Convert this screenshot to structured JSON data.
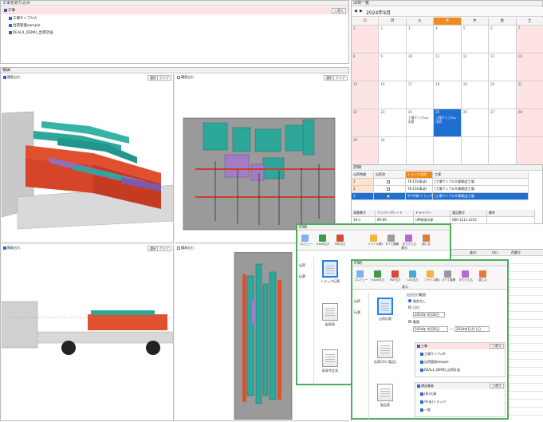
{
  "work_selector": {
    "title": "工事を絞り込み",
    "root_label": "工事",
    "button": "入替え",
    "items": [
      "工場サンプルA",
      "出荷管理sample",
      "REAL4_DEMO_出荷計画"
    ]
  },
  "viewer_panel": {
    "title": "積図",
    "view_label": "積表出力",
    "select_btn": "選択",
    "clear_btn": "クリア"
  },
  "calendar_panel": {
    "title": "出荷一覧",
    "month": "2024年9月",
    "weekdays": [
      "日",
      "月",
      "火",
      "水",
      "木",
      "金",
      "土"
    ],
    "days": [
      [
        "1",
        "2",
        "3",
        "4",
        "5",
        "6",
        "7"
      ],
      [
        "8",
        "9",
        "10",
        "11",
        "12",
        "13",
        "14"
      ],
      [
        "15",
        "16",
        "17",
        "18",
        "19",
        "20",
        "21"
      ],
      [
        "22",
        "23",
        "24",
        "25",
        "26",
        "27",
        "28"
      ],
      [
        "29",
        "30",
        "",
        "",
        "",
        "",
        ""
      ]
    ],
    "event_a": "工場サンプルA 出荷",
    "event_b": "工場サンプルA 出荷"
  },
  "detail_panel": {
    "title": "詳細",
    "headers": [
      "出荷時間",
      "出荷済",
      "トラック名称",
      "工事"
    ],
    "rows": [
      [
        "1",
        "",
        "T8-15t(車送)",
        "[工場サンプルA]車動会工場"
      ],
      [
        "2",
        "",
        "T8-15t(車送)",
        "[工場サンプルA]車動会工場"
      ],
      [
        "3",
        "",
        "ST-中車(トラック)",
        "[工場サンプルA]車動会工場"
      ]
    ],
    "vehicle_headers": [
      "車番番号",
      "ナンバープレート",
      "ドライバー",
      "電話番号",
      "備考"
    ],
    "vehicle_row": [
      "19-3",
      "89-89",
      "UM物流太郎",
      "080-1111-2222",
      ""
    ]
  },
  "print_dialog_a": {
    "title": "印刷",
    "tools": [
      "プレビュー",
      "Excel出力",
      "PDF出力",
      "ファイル開く",
      "すべて展開",
      "折りたたむ",
      "閉じる"
    ],
    "group_label": "表示",
    "side_label": "出荷",
    "side_label2": "伝票",
    "items": [
      "トラック伝票",
      "配車表",
      "配車予定表"
    ]
  },
  "print_dialog_b": {
    "title": "印刷",
    "tools": [
      "プレビュー",
      "Excel出力",
      "PDF出力",
      "CSV出力",
      "ファイル開く",
      "すべて展開",
      "折りたたむ",
      "閉じる"
    ],
    "group_label": "表示",
    "side_label": "出荷",
    "side_label2": "伝票",
    "items": [
      "出荷伝票",
      "出荷CSV (製品)",
      "製品表"
    ],
    "period_title": "出力日付範囲",
    "radio_none": "指定なし",
    "radio_date": "日付",
    "date_single": "2024年 9月26日",
    "radio_range": "範囲",
    "date_from": "2024年 9月26日",
    "date_to": "2024年11月 1日",
    "tree_works_title": "工事",
    "tree_works_btn": "入替え",
    "tree_works": [
      "工場サンプルA",
      "出荷管理sample",
      "REAL4_DEMO_出荷計画"
    ],
    "tree_carriers_title": "運送業者",
    "tree_carriers_btn": "入替え",
    "tree_carriers": [
      "(有)大貨",
      "中(あ)トラック",
      "一般"
    ]
  },
  "back_table": {
    "hdr1": "進(t)",
    "hdr2": "(m)",
    "hdr3": "荷番号"
  }
}
